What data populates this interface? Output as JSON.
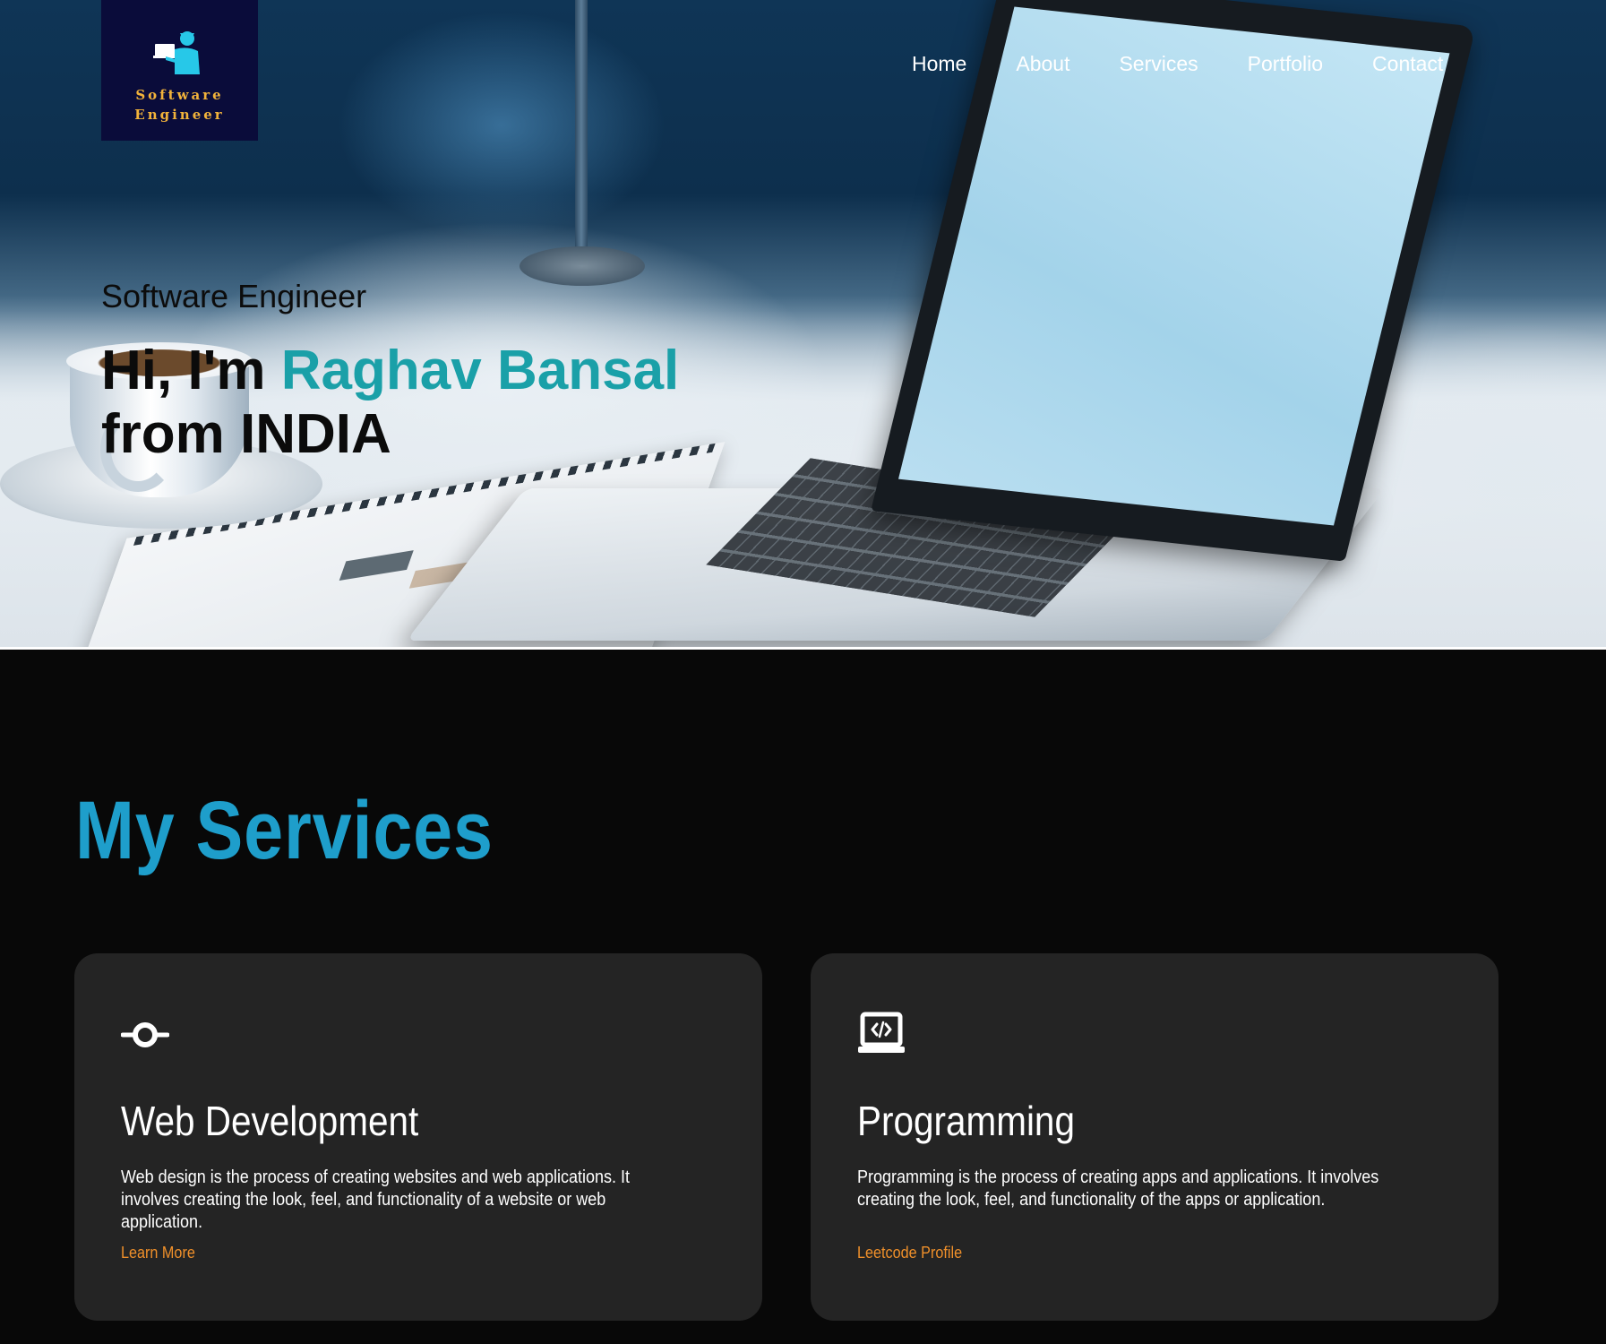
{
  "logo": {
    "text": "Software\nEngineer"
  },
  "nav": {
    "items": [
      "Home",
      "About",
      "Services",
      "Portfolio",
      "Contact"
    ]
  },
  "hero": {
    "subtitle": "Software Engineer",
    "greeting": "Hi, I'm ",
    "name": "Raghav Bansal",
    "origin": "from INDIA"
  },
  "services": {
    "heading": "My Services",
    "cards": [
      {
        "icon": "commit-icon",
        "title": "Web Development",
        "description": "Web design is the process of creating websites and web applications. It involves creating the look, feel, and functionality of a website or web application.",
        "link": "Learn More"
      },
      {
        "icon": "laptop-code-icon",
        "title": "Programming",
        "description": "Programming is the process of creating apps and applications. It involves creating the look, feel, and functionality of the apps or application.",
        "link": "Leetcode Profile"
      }
    ]
  },
  "colors": {
    "accent_name": "#1aa0a8",
    "heading": "#1e9ecb",
    "link": "#f0902a",
    "card_bg": "#242424",
    "page_bg": "#080808",
    "logo_bg": "#0a0c3a",
    "logo_text": "#f2b33a"
  }
}
